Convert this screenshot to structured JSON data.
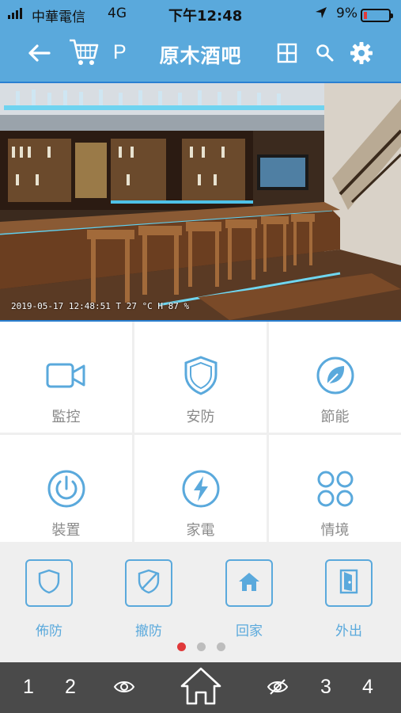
{
  "status_bar": {
    "carrier": "中華電信",
    "network": "4G",
    "time": "下午12:48",
    "battery": "9%"
  },
  "nav": {
    "p_label": "P",
    "title": "原木酒吧"
  },
  "camera": {
    "overlay_text": "2019-05-17 12:48:51   T 27 °C  H 87 %"
  },
  "features": [
    {
      "label": "監控",
      "icon": "video-camera-icon"
    },
    {
      "label": "安防",
      "icon": "shield-icon"
    },
    {
      "label": "節能",
      "icon": "leaf-icon"
    },
    {
      "label": "裝置",
      "icon": "power-icon"
    },
    {
      "label": "家電",
      "icon": "lightning-icon"
    },
    {
      "label": "情境",
      "icon": "four-circles-icon"
    }
  ],
  "quick_actions": [
    {
      "label": "佈防",
      "icon": "shield-icon"
    },
    {
      "label": "撤防",
      "icon": "shield-off-icon"
    },
    {
      "label": "回家",
      "icon": "home-icon"
    },
    {
      "label": "外出",
      "icon": "exit-door-icon"
    }
  ],
  "pager": {
    "count": 3,
    "active": 1
  },
  "bottom_bar": {
    "left_1": "1",
    "left_2": "2",
    "right_3": "3",
    "right_4": "4"
  },
  "colors": {
    "accent": "#5aa9dc",
    "bottom_bar": "#4a4a4a",
    "pager_active": "#e0393a"
  }
}
